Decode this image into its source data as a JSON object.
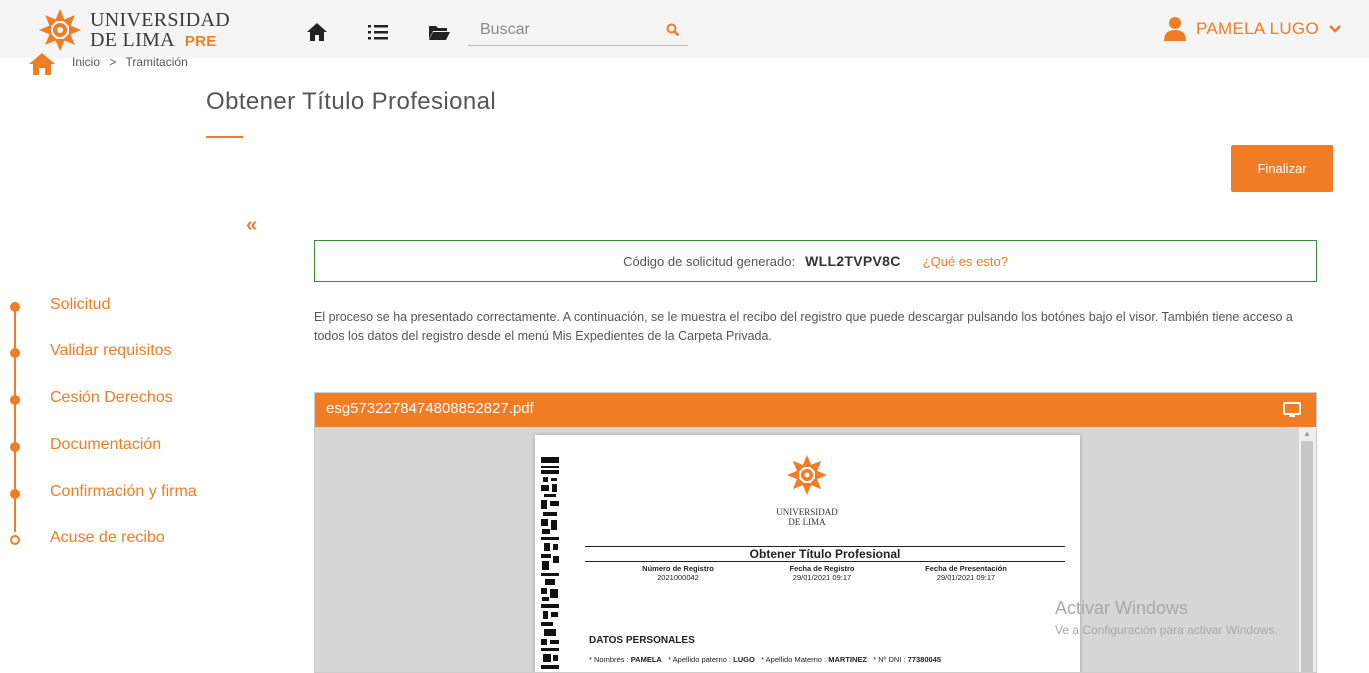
{
  "header": {
    "logo_line1": "UNIVERSIDAD",
    "logo_line2": "DE LIMA",
    "logo_badge": "PRE",
    "search_placeholder": "Buscar",
    "user_name": "PAMELA LUGO",
    "icons": [
      "home-icon",
      "list-icon",
      "folder-icon",
      "search-icon",
      "user-icon",
      "chevron-down-icon"
    ]
  },
  "breadcrumb": {
    "home": "Inicio",
    "separator": ">",
    "current": "Tramitación"
  },
  "page": {
    "title": "Obtener Título Profesional",
    "finalize_label": "Finalizar",
    "collapse_label": "«"
  },
  "steps": [
    {
      "label": "Solicitud"
    },
    {
      "label": "Validar requisitos"
    },
    {
      "label": "Cesión Derechos"
    },
    {
      "label": "Documentación"
    },
    {
      "label": "Confirmación y firma"
    },
    {
      "label": "Acuse de recibo"
    }
  ],
  "code_box": {
    "label": "Código de solicitud generado:",
    "value": "WLL2TVPV8C",
    "help_link": "¿Qué es esto?"
  },
  "info_text": "El proceso se ha presentado correctamente. A continuación, se le muestra el recibo del registro que puede descargar pulsando los botónes bajo el visor. También tiene acceso a todos los datos del registro desde el menú Mis Expedientes de la Carpeta Privada.",
  "viewer": {
    "file_name": "esg5732278474808852827.pdf",
    "pdf": {
      "uni_line1": "UNIVERSIDAD",
      "uni_line2": "DE LIMA",
      "title": "Obtener Título Profesional",
      "col1_label": "Número de Registro",
      "col1_value": "2021000042",
      "col2_label": "Fecha de Registro",
      "col2_value": "29/01/2021 09:17",
      "col3_label": "Fecha de Presentación",
      "col3_value": "29/01/2021 09:17",
      "section": "DATOS PERSONALES",
      "nombres_label": "* Nombres :",
      "nombres": "PAMELA",
      "apellido_paterno_label": "* Apellido paterno :",
      "apellido_paterno": "LUGO",
      "apellido_materno_label": "* Apellido Materno :",
      "apellido_materno": "MARTINEZ",
      "dni_label": "* Nº DNI :",
      "dni": "77380045"
    }
  },
  "watermark": {
    "line1": "Activar Windows",
    "line2": "Ve a Configuración para activar Windows."
  },
  "colors": {
    "accent": "#f07c26",
    "code_border": "#3a8a3a"
  }
}
